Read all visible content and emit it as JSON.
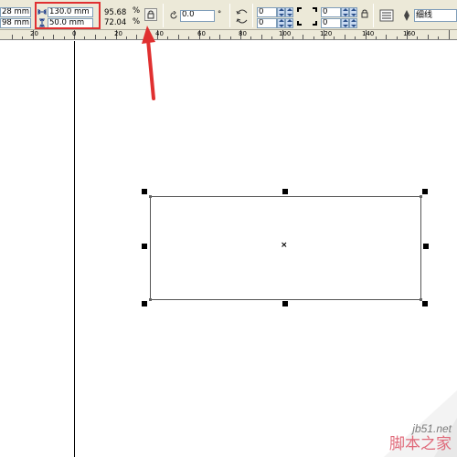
{
  "toolbar": {
    "position": {
      "x": "28 mm",
      "y": "98 mm"
    },
    "size": {
      "width": "130.0 mm",
      "height": "50.0 mm"
    },
    "scale": {
      "x": "95.68",
      "y": "72.04"
    },
    "percent_symbol": "%",
    "rotation": "0.0",
    "degree_symbol": "°",
    "corner_top": {
      "left": "0",
      "right": "0"
    },
    "corner_bottom": {
      "left": "0",
      "right": "0"
    },
    "outline_width": "细线"
  },
  "ruler": {
    "labels": [
      "20",
      "0",
      "20",
      "40",
      "60",
      "80",
      "100",
      "120",
      "140",
      "160"
    ]
  },
  "watermark": {
    "site": "jb51.net",
    "name": "脚本之家"
  },
  "colors": {
    "highlight": "#e03030",
    "toolbar_bg": "#ece9d8",
    "watermark_text": "#e06a7a"
  }
}
